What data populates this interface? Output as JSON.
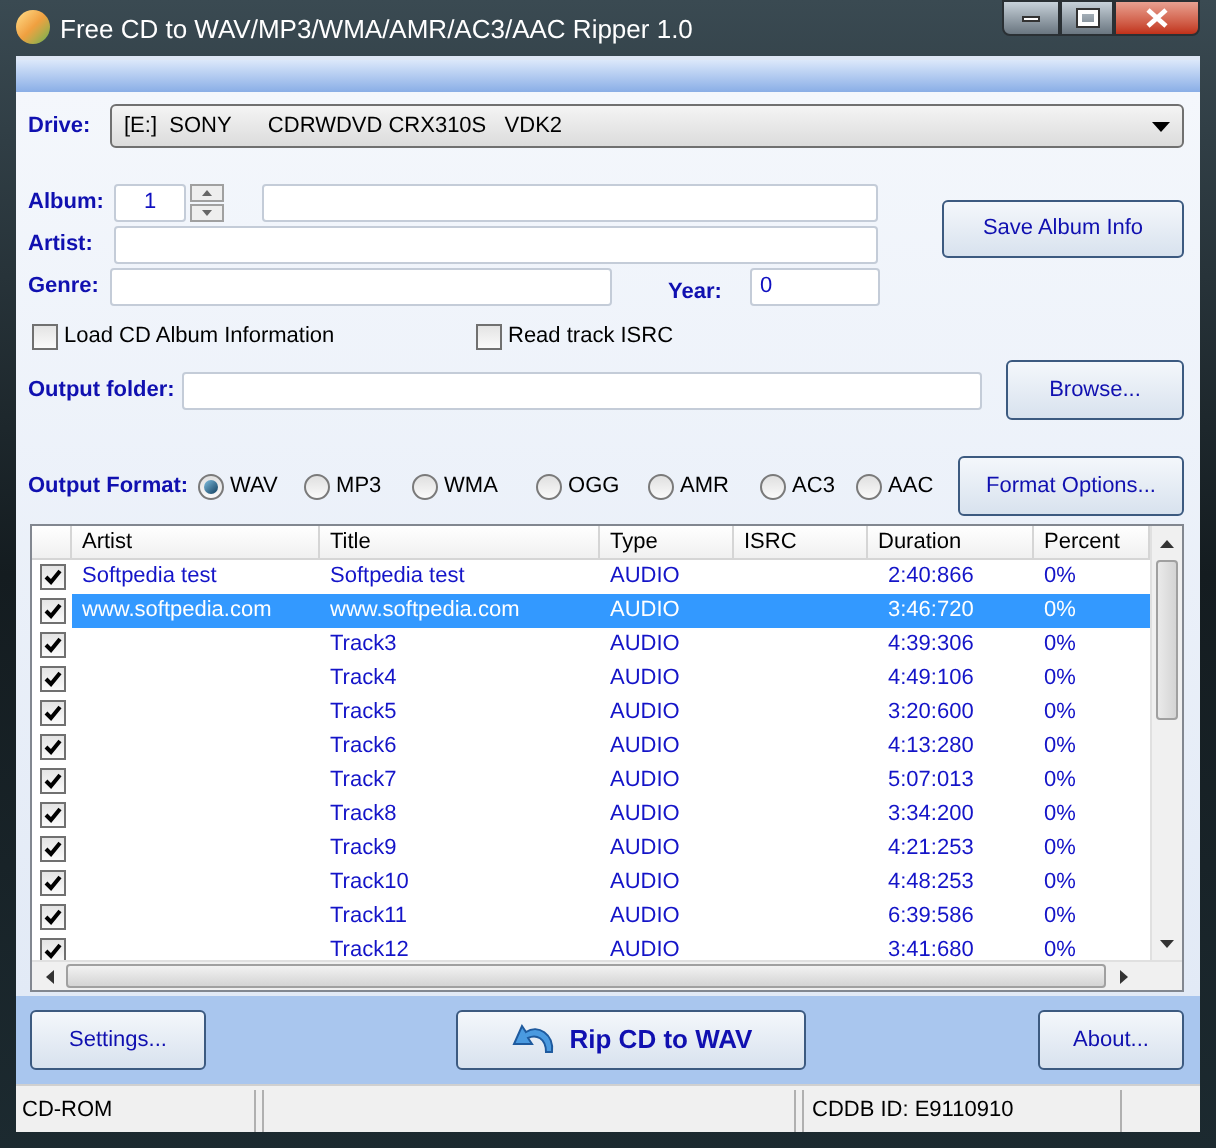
{
  "window": {
    "title": "Free CD to WAV/MP3/WMA/AMR/AC3/AAC Ripper 1.0"
  },
  "drive": {
    "label": "Drive:",
    "value": "[E:]  SONY      CDRWDVD CRX310S   VDK2"
  },
  "album": {
    "label": "Album:",
    "number": "1"
  },
  "artist": {
    "label": "Artist:"
  },
  "genre": {
    "label": "Genre:"
  },
  "year": {
    "label": "Year:",
    "value": "0"
  },
  "save_button": "Save Album Info",
  "options": [
    {
      "label": "Load CD Album Information",
      "checked": false
    },
    {
      "label": "Read track ISRC",
      "checked": false
    }
  ],
  "output_folder": {
    "label": "Output folder:"
  },
  "browse_button": "Browse...",
  "output_format": {
    "label": "Output Format:",
    "formats": [
      {
        "label": "WAV",
        "selected": true
      },
      {
        "label": "MP3",
        "selected": false
      },
      {
        "label": "WMA",
        "selected": false
      },
      {
        "label": "OGG",
        "selected": false
      },
      {
        "label": "AMR",
        "selected": false
      },
      {
        "label": "AC3",
        "selected": false
      },
      {
        "label": "AAC",
        "selected": false
      }
    ]
  },
  "format_options_button": "Format Options...",
  "table": {
    "columns": [
      "Artist",
      "Title",
      "Type",
      "ISRC",
      "Duration",
      "Percent"
    ],
    "rows": [
      {
        "checked": true,
        "selected": false,
        "cells": [
          "Softpedia test",
          "Softpedia test",
          "AUDIO",
          "",
          "2:40:866",
          "0%"
        ]
      },
      {
        "checked": true,
        "selected": true,
        "cells": [
          "www.softpedia.com",
          "www.softpedia.com",
          "AUDIO",
          "",
          "3:46:720",
          "0%"
        ]
      },
      {
        "checked": true,
        "selected": false,
        "cells": [
          "",
          "Track3",
          "AUDIO",
          "",
          "4:39:306",
          "0%"
        ]
      },
      {
        "checked": true,
        "selected": false,
        "cells": [
          "",
          "Track4",
          "AUDIO",
          "",
          "4:49:106",
          "0%"
        ]
      },
      {
        "checked": true,
        "selected": false,
        "cells": [
          "",
          "Track5",
          "AUDIO",
          "",
          "3:20:600",
          "0%"
        ]
      },
      {
        "checked": true,
        "selected": false,
        "cells": [
          "",
          "Track6",
          "AUDIO",
          "",
          "4:13:280",
          "0%"
        ]
      },
      {
        "checked": true,
        "selected": false,
        "cells": [
          "",
          "Track7",
          "AUDIO",
          "",
          "5:07:013",
          "0%"
        ]
      },
      {
        "checked": true,
        "selected": false,
        "cells": [
          "",
          "Track8",
          "AUDIO",
          "",
          "3:34:200",
          "0%"
        ]
      },
      {
        "checked": true,
        "selected": false,
        "cells": [
          "",
          "Track9",
          "AUDIO",
          "",
          "4:21:253",
          "0%"
        ]
      },
      {
        "checked": true,
        "selected": false,
        "cells": [
          "",
          "Track10",
          "AUDIO",
          "",
          "4:48:253",
          "0%"
        ]
      },
      {
        "checked": true,
        "selected": false,
        "cells": [
          "",
          "Track11",
          "AUDIO",
          "",
          "6:39:586",
          "0%"
        ]
      },
      {
        "checked": true,
        "selected": false,
        "cells": [
          "",
          "Track12",
          "AUDIO",
          "",
          "3:41:680",
          "0%"
        ]
      }
    ]
  },
  "buttons": {
    "settings": "Settings...",
    "rip": "Rip CD to WAV",
    "about": "About..."
  },
  "status_bar": {
    "left": "CD-ROM",
    "right": "CDDB ID: E9110910"
  }
}
